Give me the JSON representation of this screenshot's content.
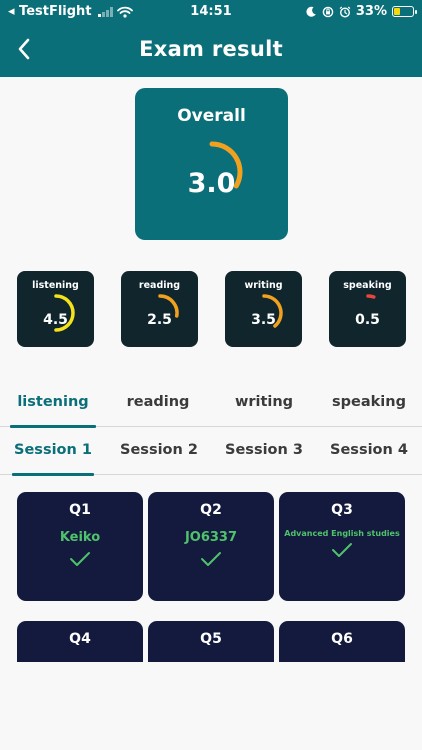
{
  "status": {
    "carrier": "◂ TestFlight",
    "time": "14:51",
    "battery": "33%",
    "battery_level": 0.33
  },
  "header": {
    "title": "Exam result"
  },
  "overall": {
    "label": "Overall",
    "score": "3.0",
    "max": 9,
    "gauge_color": "#f2a11f"
  },
  "skills": [
    {
      "label": "listening",
      "score": "4.5",
      "color": "#f5e21c"
    },
    {
      "label": "reading",
      "score": "2.5",
      "color": "#f2a11f"
    },
    {
      "label": "writing",
      "score": "3.5",
      "color": "#f2a11f"
    },
    {
      "label": "speaking",
      "score": "0.5",
      "color": "#e8453c"
    }
  ],
  "skill_tabs": [
    "listening",
    "reading",
    "writing",
    "speaking"
  ],
  "active_skill_tab": 0,
  "session_tabs": [
    "Session 1",
    "Session 2",
    "Session 3",
    "Session 4"
  ],
  "active_session_tab": 0,
  "questions": [
    {
      "label": "Q1",
      "answer": "Keiko",
      "correct": true
    },
    {
      "label": "Q2",
      "answer": "JO6337",
      "correct": true
    },
    {
      "label": "Q3",
      "answer": "Advanced English studies",
      "correct": true
    },
    {
      "label": "Q4",
      "answer": "",
      "correct": null
    },
    {
      "label": "Q5",
      "answer": "",
      "correct": null
    },
    {
      "label": "Q6",
      "answer": "",
      "correct": null
    }
  ],
  "colors": {
    "brand": "#0b6f79",
    "card_dark": "#10262c",
    "question_card": "#131a3e",
    "correct": "#4fc26b"
  }
}
